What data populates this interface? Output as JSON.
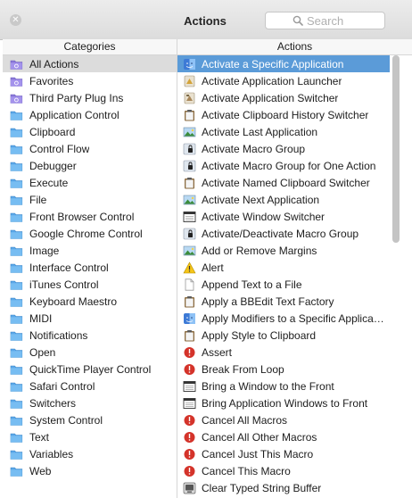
{
  "window": {
    "title": "Actions"
  },
  "search": {
    "placeholder": "Search"
  },
  "columns": {
    "categories": "Categories",
    "actions": "Actions"
  },
  "categories": [
    {
      "label": "All Actions",
      "icon": "smart-folder-icon",
      "selected": true
    },
    {
      "label": "Favorites",
      "icon": "smart-folder-icon"
    },
    {
      "label": "Third Party Plug Ins",
      "icon": "smart-folder-icon"
    },
    {
      "label": "Application Control",
      "icon": "folder-icon"
    },
    {
      "label": "Clipboard",
      "icon": "folder-icon"
    },
    {
      "label": "Control Flow",
      "icon": "folder-icon"
    },
    {
      "label": "Debugger",
      "icon": "folder-icon"
    },
    {
      "label": "Execute",
      "icon": "folder-icon"
    },
    {
      "label": "File",
      "icon": "folder-icon"
    },
    {
      "label": "Front Browser Control",
      "icon": "folder-icon"
    },
    {
      "label": "Google Chrome Control",
      "icon": "folder-icon"
    },
    {
      "label": "Image",
      "icon": "folder-icon"
    },
    {
      "label": "Interface Control",
      "icon": "folder-icon"
    },
    {
      "label": "iTunes Control",
      "icon": "folder-icon"
    },
    {
      "label": "Keyboard Maestro",
      "icon": "folder-icon"
    },
    {
      "label": "MIDI",
      "icon": "folder-icon"
    },
    {
      "label": "Notifications",
      "icon": "folder-icon"
    },
    {
      "label": "Open",
      "icon": "folder-icon"
    },
    {
      "label": "QuickTime Player Control",
      "icon": "folder-icon"
    },
    {
      "label": "Safari Control",
      "icon": "folder-icon"
    },
    {
      "label": "Switchers",
      "icon": "folder-icon"
    },
    {
      "label": "System Control",
      "icon": "folder-icon"
    },
    {
      "label": "Text",
      "icon": "folder-icon"
    },
    {
      "label": "Variables",
      "icon": "folder-icon"
    },
    {
      "label": "Web",
      "icon": "folder-icon"
    }
  ],
  "actions": [
    {
      "label": "Activate a Specific Application",
      "icon": "finder-app-icon",
      "selected": true
    },
    {
      "label": "Activate Application Launcher",
      "icon": "launcher-icon"
    },
    {
      "label": "Activate Application Switcher",
      "icon": "switcher-icon"
    },
    {
      "label": "Activate Clipboard History Switcher",
      "icon": "clipboard-icon"
    },
    {
      "label": "Activate Last Application",
      "icon": "image-app-icon"
    },
    {
      "label": "Activate Macro Group",
      "icon": "macro-group-icon"
    },
    {
      "label": "Activate Macro Group for One Action",
      "icon": "macro-group-icon"
    },
    {
      "label": "Activate Named Clipboard Switcher",
      "icon": "clipboard-icon"
    },
    {
      "label": "Activate Next Application",
      "icon": "image-app-icon"
    },
    {
      "label": "Activate Window Switcher",
      "icon": "window-icon"
    },
    {
      "label": "Activate/Deactivate Macro Group",
      "icon": "macro-group-icon"
    },
    {
      "label": "Add or Remove Margins",
      "icon": "image-app-icon"
    },
    {
      "label": "Alert",
      "icon": "warning-icon"
    },
    {
      "label": "Append Text to a File",
      "icon": "document-icon"
    },
    {
      "label": "Apply a BBEdit Text Factory",
      "icon": "clipboard-icon"
    },
    {
      "label": "Apply Modifiers to a Specific Applicati...",
      "icon": "finder-app-icon"
    },
    {
      "label": "Apply Style to Clipboard",
      "icon": "clipboard-icon"
    },
    {
      "label": "Assert",
      "icon": "stop-icon"
    },
    {
      "label": "Break From Loop",
      "icon": "stop-icon"
    },
    {
      "label": "Bring a Window to the Front",
      "icon": "window-icon"
    },
    {
      "label": "Bring Application Windows to Front",
      "icon": "window-icon"
    },
    {
      "label": "Cancel All Macros",
      "icon": "stop-icon"
    },
    {
      "label": "Cancel All Other Macros",
      "icon": "stop-icon"
    },
    {
      "label": "Cancel Just This Macro",
      "icon": "stop-icon"
    },
    {
      "label": "Cancel This Macro",
      "icon": "stop-icon"
    },
    {
      "label": "Clear Typed String Buffer",
      "icon": "keyboard-icon"
    }
  ]
}
